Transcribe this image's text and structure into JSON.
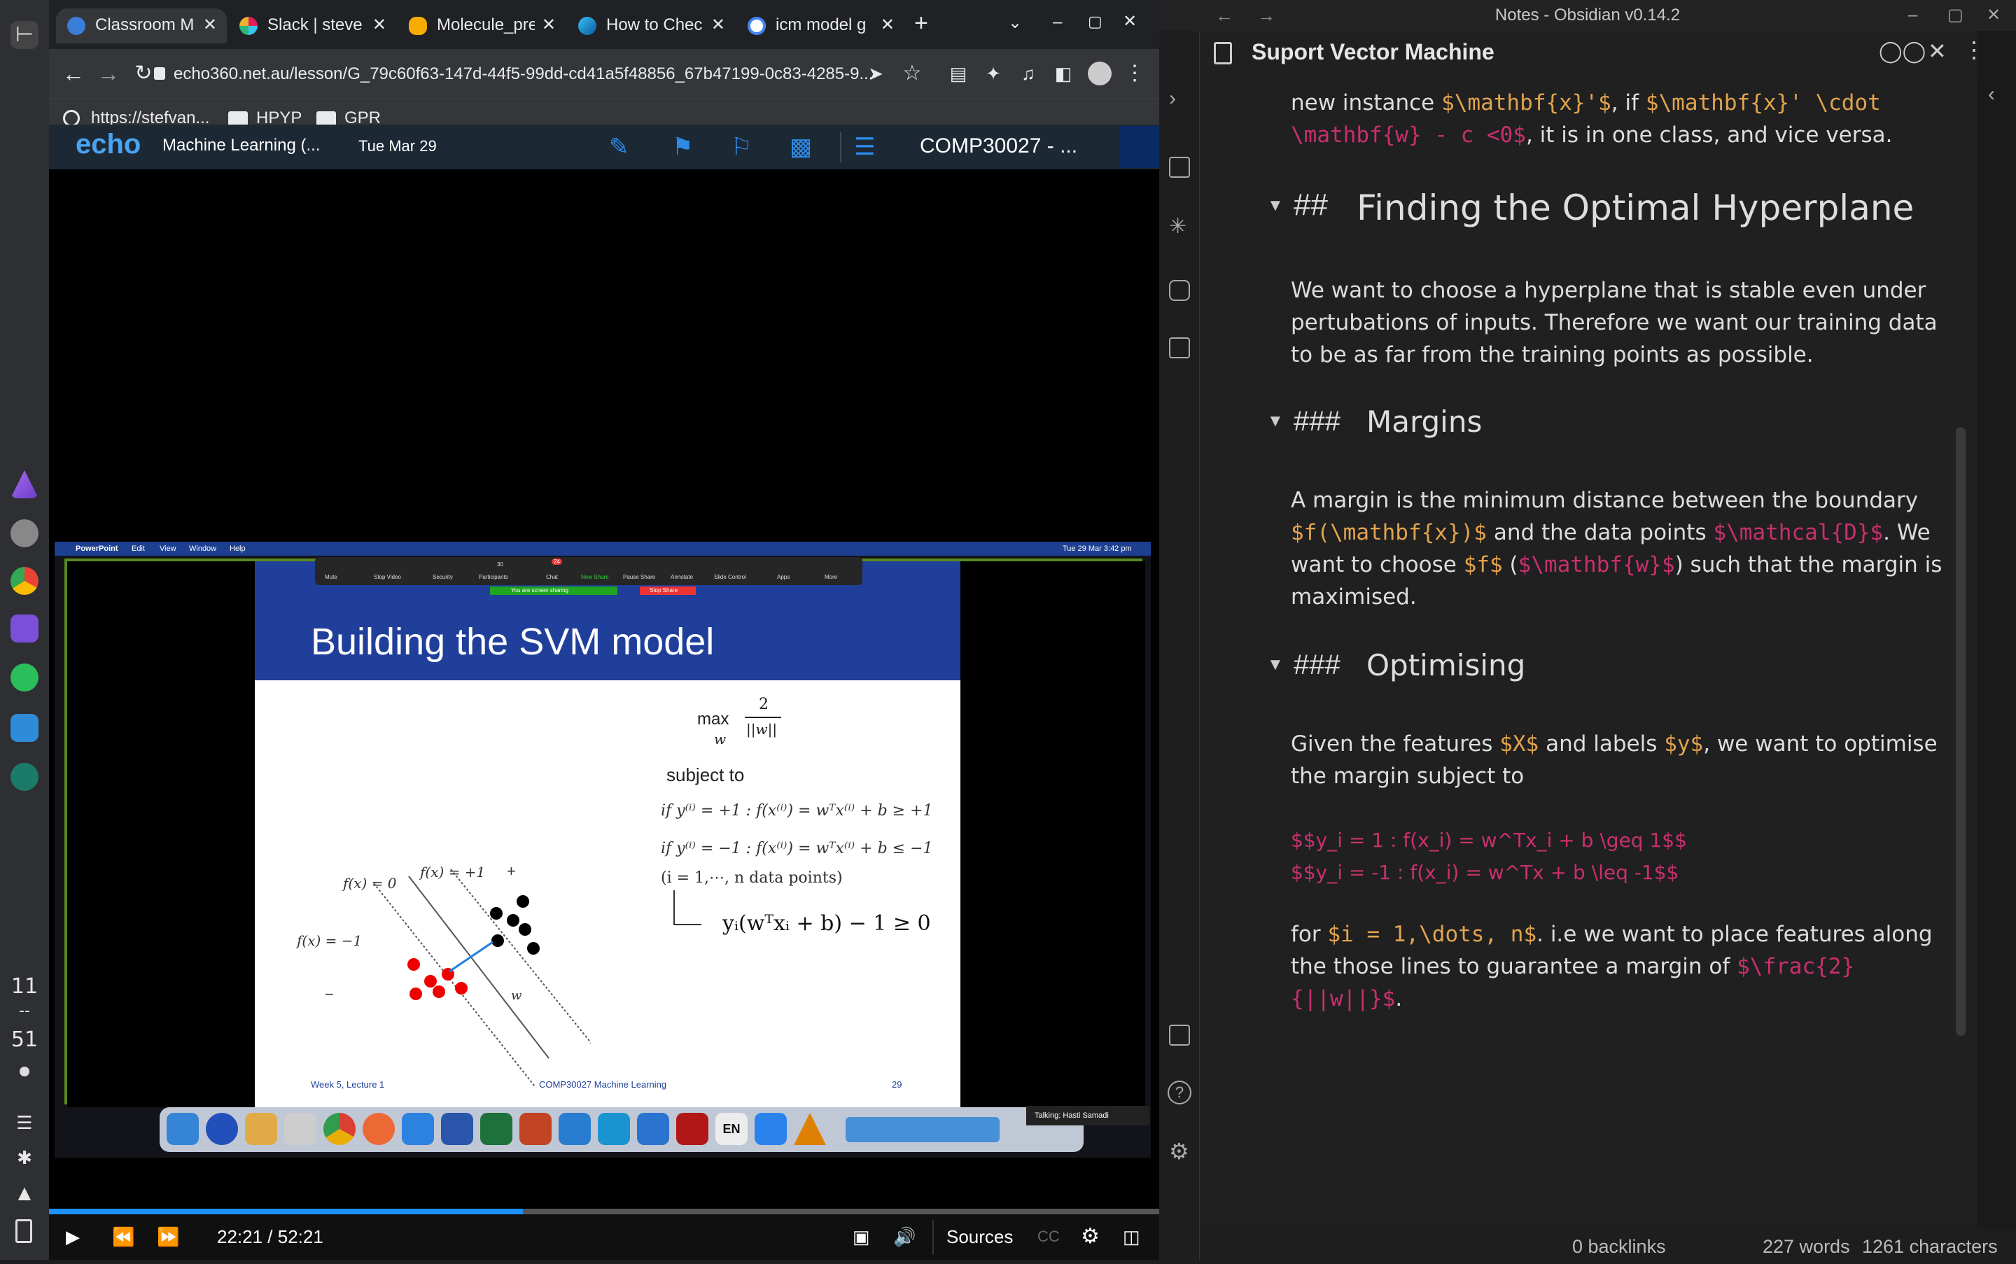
{
  "dock": {
    "clock_hour": "11",
    "clock_sep": "--",
    "clock_min": "51"
  },
  "browser": {
    "tabs": [
      {
        "label": "Classroom M",
        "favicon": "echo-icon",
        "active": true
      },
      {
        "label": "Slack | steve",
        "favicon": "slack-icon",
        "active": false
      },
      {
        "label": "Molecule_pre",
        "favicon": "colab-icon",
        "active": false
      },
      {
        "label": "How to Chec",
        "favicon": "edge-icon",
        "active": false
      },
      {
        "label": "icm model g",
        "favicon": "google-icon",
        "active": false
      }
    ],
    "new_tab": "+",
    "url": "echo360.net.au/lesson/G_79c60f63-147d-44f5-99dd-cd41a5f48856_67b47199-0c83-4285-9...",
    "bookmarks": [
      "https://stefvan...",
      "HPYP",
      "GPR"
    ]
  },
  "echo": {
    "logo": "echo",
    "course": "Machine Learning (...",
    "date": "Tue Mar 29",
    "course_code": "COMP30027 - ..."
  },
  "share": {
    "menubar": {
      "app": "PowerPoint",
      "items": [
        "Edit",
        "View",
        "Window",
        "Help"
      ],
      "clock": "Tue 29 Mar  3:42 pm"
    },
    "zoom_buttons": [
      "Mute",
      "Stop Video",
      "Security",
      "Participants",
      "Chat",
      "New Share",
      "Pause Share",
      "Annotate",
      "Slide Control",
      "Apps",
      "More"
    ],
    "participants_count": "30",
    "chat_badge": "24",
    "sharing_text": "You are screen sharing",
    "stop_share": "Stop Share",
    "talking": "Talking: Hasti Samadi",
    "slide": {
      "title": "Building the SVM model",
      "max_label": "max",
      "max_sub": "w",
      "frac_num": "2",
      "frac_den": "||w||",
      "subject_to": "subject to",
      "cond1": "if y⁽ⁱ⁾ = +1 : f(x⁽ⁱ⁾) = wᵀx⁽ⁱ⁾ + b ≥ +1",
      "cond2": "if y⁽ⁱ⁾ = −1 : f(x⁽ⁱ⁾) = wᵀx⁽ⁱ⁾ + b ≤ −1",
      "cond3": "(i = 1,⋯, n data points)",
      "result": "yᵢ(wᵀxᵢ + b) − 1 ≥ 0",
      "fx0": "f(x) = 0",
      "fxp": "f(x) = +1",
      "fxm": "f(x) = −1",
      "plus": "+",
      "minus": "−",
      "w_label": "w",
      "footer_left": "Week 5, Lecture 1",
      "footer_mid": "COMP30027 Machine Learning",
      "footer_right": "29"
    },
    "dock_lang": "EN"
  },
  "player": {
    "time": "22:21 / 52:21",
    "progress": 0.427,
    "sources": "Sources",
    "cc": "CC"
  },
  "obsidian": {
    "window_title": "Notes - Obsidian v0.14.2",
    "note_title": "Suport Vector Machine",
    "intro_line1": [
      "new instance ",
      "$\\mathbf{x}'$",
      ", if ",
      "$\\mathbf{x}' \\cdot",
      ""
    ],
    "intro_line2": [
      "\\mathbf{w} - c <0$",
      ", it is in one class, and vice versa."
    ],
    "h2_marker": "##",
    "h2": "Finding the Optimal Hyperplane",
    "p1": "We want to choose a hyperplane that is stable even under pertubations of inputs. Therefore we want our training data to be as far from the training points as possible.",
    "h3_marker": "###",
    "h3a": "Margins",
    "p2_a": "A margin is the minimum distance between the boundary",
    "p2_m1": "$f(\\mathbf{x})$",
    "p2_b": " and the data points ",
    "p2_m2": "$\\mathcal{D}$",
    "p2_c": ". We want to choose ",
    "p2_m3": "$f$",
    "p2_d": " (",
    "p2_m4": "$\\mathbf{w}$",
    "p2_e": ") such that the margin is maximised.",
    "h3b": "Optimising",
    "p3_a": "Given the features ",
    "p3_m1": "$X$",
    "p3_b": " and labels ",
    "p3_m2": "$y$",
    "p3_c": ", we want to optimise the margin subject to",
    "eq1": "$$y_i = 1 : f(x_i) = w^Tx_i + b \\geq 1$$",
    "eq2": "$$y_i = -1 : f(x_i) = w^Tx + b \\leq -1$$",
    "p4_a": "for ",
    "p4_m1": "$i = 1,\\dots, n$",
    "p4_b": ". i.e we want to place features along the those lines to guarantee a margin of ",
    "p4_m2": "$\\frac{2}{||w||}$",
    "p4_c": ".",
    "status_backlinks": "0 backlinks",
    "status_words": "227 words",
    "status_chars": "1261 characters"
  },
  "colors": {
    "slide_blue": "#1f3f9a",
    "progress": "#1e90ff",
    "math_orange": "#e1a34e",
    "math_magenta": "#c8306d"
  }
}
